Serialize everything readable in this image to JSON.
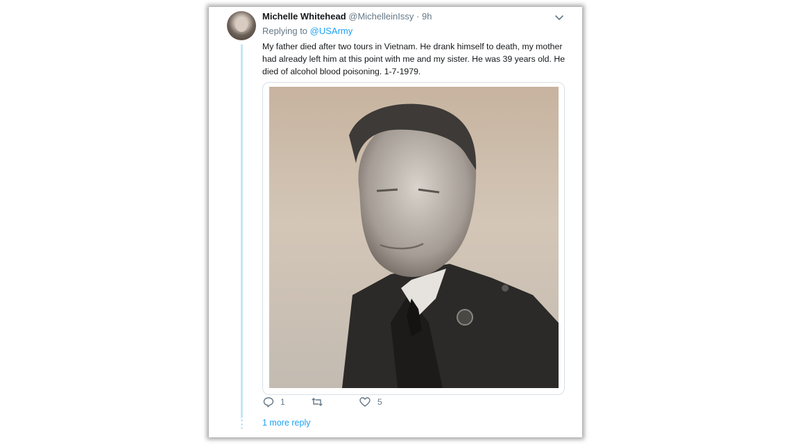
{
  "tweet": {
    "author_name": "Michelle Whitehead",
    "author_handle": "@MichelleinIssy",
    "separator": "·",
    "time": "9h",
    "replying_prefix": "Replying to",
    "replying_mention": "@USArmy",
    "text": "My father died after two tours in Vietnam. He drank himself to death, my mother had already left him at this point with me and my sister. He was 39 years old. He died of alcohol blood poisoning. 1-7-1979."
  },
  "actions": {
    "reply_count": "1",
    "retweet_count": "",
    "like_count": "5"
  },
  "thread": {
    "more_replies_label": "1 more reply"
  },
  "icons": {
    "caret": "chevron-down-icon",
    "reply": "reply-icon",
    "retweet": "retweet-icon",
    "like": "heart-icon"
  },
  "colors": {
    "accent": "#1da1f2",
    "thread_line": "#c4e6f8",
    "muted": "#657786",
    "text": "#14171a"
  }
}
